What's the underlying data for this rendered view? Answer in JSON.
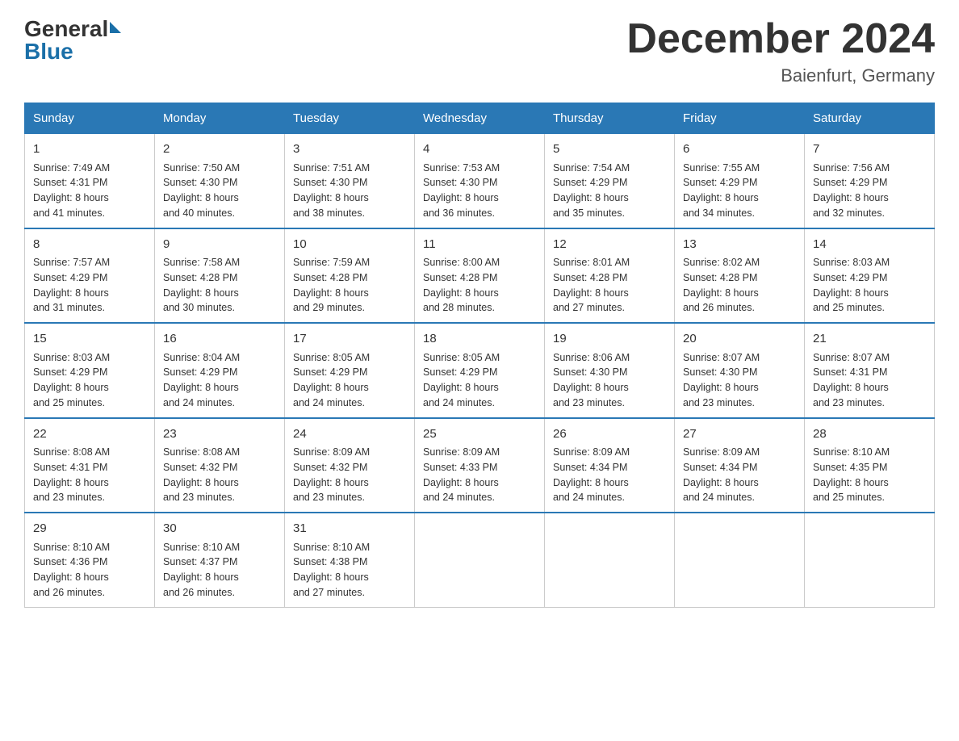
{
  "header": {
    "logo_general": "General",
    "logo_blue": "Blue",
    "month_title": "December 2024",
    "location": "Baienfurt, Germany"
  },
  "days_of_week": [
    "Sunday",
    "Monday",
    "Tuesday",
    "Wednesday",
    "Thursday",
    "Friday",
    "Saturday"
  ],
  "weeks": [
    [
      {
        "day": "1",
        "sunrise": "7:49 AM",
        "sunset": "4:31 PM",
        "daylight": "8 hours and 41 minutes."
      },
      {
        "day": "2",
        "sunrise": "7:50 AM",
        "sunset": "4:30 PM",
        "daylight": "8 hours and 40 minutes."
      },
      {
        "day": "3",
        "sunrise": "7:51 AM",
        "sunset": "4:30 PM",
        "daylight": "8 hours and 38 minutes."
      },
      {
        "day": "4",
        "sunrise": "7:53 AM",
        "sunset": "4:30 PM",
        "daylight": "8 hours and 36 minutes."
      },
      {
        "day": "5",
        "sunrise": "7:54 AM",
        "sunset": "4:29 PM",
        "daylight": "8 hours and 35 minutes."
      },
      {
        "day": "6",
        "sunrise": "7:55 AM",
        "sunset": "4:29 PM",
        "daylight": "8 hours and 34 minutes."
      },
      {
        "day": "7",
        "sunrise": "7:56 AM",
        "sunset": "4:29 PM",
        "daylight": "8 hours and 32 minutes."
      }
    ],
    [
      {
        "day": "8",
        "sunrise": "7:57 AM",
        "sunset": "4:29 PM",
        "daylight": "8 hours and 31 minutes."
      },
      {
        "day": "9",
        "sunrise": "7:58 AM",
        "sunset": "4:28 PM",
        "daylight": "8 hours and 30 minutes."
      },
      {
        "day": "10",
        "sunrise": "7:59 AM",
        "sunset": "4:28 PM",
        "daylight": "8 hours and 29 minutes."
      },
      {
        "day": "11",
        "sunrise": "8:00 AM",
        "sunset": "4:28 PM",
        "daylight": "8 hours and 28 minutes."
      },
      {
        "day": "12",
        "sunrise": "8:01 AM",
        "sunset": "4:28 PM",
        "daylight": "8 hours and 27 minutes."
      },
      {
        "day": "13",
        "sunrise": "8:02 AM",
        "sunset": "4:28 PM",
        "daylight": "8 hours and 26 minutes."
      },
      {
        "day": "14",
        "sunrise": "8:03 AM",
        "sunset": "4:29 PM",
        "daylight": "8 hours and 25 minutes."
      }
    ],
    [
      {
        "day": "15",
        "sunrise": "8:03 AM",
        "sunset": "4:29 PM",
        "daylight": "8 hours and 25 minutes."
      },
      {
        "day": "16",
        "sunrise": "8:04 AM",
        "sunset": "4:29 PM",
        "daylight": "8 hours and 24 minutes."
      },
      {
        "day": "17",
        "sunrise": "8:05 AM",
        "sunset": "4:29 PM",
        "daylight": "8 hours and 24 minutes."
      },
      {
        "day": "18",
        "sunrise": "8:05 AM",
        "sunset": "4:29 PM",
        "daylight": "8 hours and 24 minutes."
      },
      {
        "day": "19",
        "sunrise": "8:06 AM",
        "sunset": "4:30 PM",
        "daylight": "8 hours and 23 minutes."
      },
      {
        "day": "20",
        "sunrise": "8:07 AM",
        "sunset": "4:30 PM",
        "daylight": "8 hours and 23 minutes."
      },
      {
        "day": "21",
        "sunrise": "8:07 AM",
        "sunset": "4:31 PM",
        "daylight": "8 hours and 23 minutes."
      }
    ],
    [
      {
        "day": "22",
        "sunrise": "8:08 AM",
        "sunset": "4:31 PM",
        "daylight": "8 hours and 23 minutes."
      },
      {
        "day": "23",
        "sunrise": "8:08 AM",
        "sunset": "4:32 PM",
        "daylight": "8 hours and 23 minutes."
      },
      {
        "day": "24",
        "sunrise": "8:09 AM",
        "sunset": "4:32 PM",
        "daylight": "8 hours and 23 minutes."
      },
      {
        "day": "25",
        "sunrise": "8:09 AM",
        "sunset": "4:33 PM",
        "daylight": "8 hours and 24 minutes."
      },
      {
        "day": "26",
        "sunrise": "8:09 AM",
        "sunset": "4:34 PM",
        "daylight": "8 hours and 24 minutes."
      },
      {
        "day": "27",
        "sunrise": "8:09 AM",
        "sunset": "4:34 PM",
        "daylight": "8 hours and 24 minutes."
      },
      {
        "day": "28",
        "sunrise": "8:10 AM",
        "sunset": "4:35 PM",
        "daylight": "8 hours and 25 minutes."
      }
    ],
    [
      {
        "day": "29",
        "sunrise": "8:10 AM",
        "sunset": "4:36 PM",
        "daylight": "8 hours and 26 minutes."
      },
      {
        "day": "30",
        "sunrise": "8:10 AM",
        "sunset": "4:37 PM",
        "daylight": "8 hours and 26 minutes."
      },
      {
        "day": "31",
        "sunrise": "8:10 AM",
        "sunset": "4:38 PM",
        "daylight": "8 hours and 27 minutes."
      },
      null,
      null,
      null,
      null
    ]
  ],
  "labels": {
    "sunrise": "Sunrise:",
    "sunset": "Sunset:",
    "daylight": "Daylight:"
  }
}
